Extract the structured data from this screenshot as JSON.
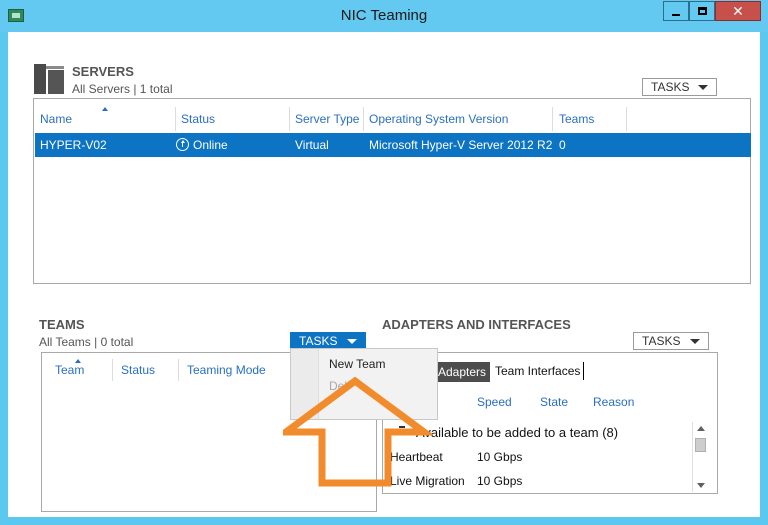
{
  "window": {
    "title": "NIC Teaming",
    "min_label": "",
    "max_label": "",
    "close_label": "✕"
  },
  "servers": {
    "title": "SERVERS",
    "subtitle": "All Servers | 1 total",
    "tasks_label": "TASKS",
    "columns": [
      "Name",
      "Status",
      "Server Type",
      "Operating System Version",
      "Teams"
    ],
    "rows": [
      {
        "name": "HYPER-V02",
        "status": "Online",
        "server_type": "Virtual",
        "os": "Microsoft Hyper-V Server 2012 R2",
        "teams": "0"
      }
    ]
  },
  "teams": {
    "title": "TEAMS",
    "subtitle": "All Teams | 0 total",
    "tasks_label": "TASKS",
    "columns": [
      "Team",
      "Status",
      "Teaming Mode"
    ],
    "menu": [
      "New Team",
      "Del"
    ]
  },
  "adapters": {
    "title": "ADAPTERS AND INTERFACES",
    "tasks_label": "TASKS",
    "tabs": [
      "Adapters",
      "Team Interfaces"
    ],
    "columns": [
      "Speed",
      "State",
      "Reason"
    ],
    "group_title": "Available to be added to a team (8)",
    "rows": [
      {
        "name": "Heartbeat",
        "speed": "10 Gbps"
      },
      {
        "name": "Live Migration",
        "speed": "10 Gbps"
      }
    ]
  },
  "colors": {
    "selection": "#0d73c3",
    "header_text": "#2a6fbf",
    "highlight_arrow": "#f28b2c",
    "title_bar": "#63c9f0"
  }
}
